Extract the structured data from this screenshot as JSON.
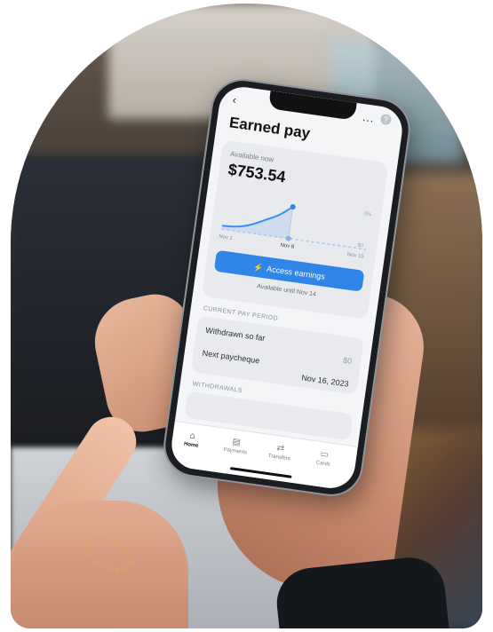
{
  "app": {
    "title": "Earned pay",
    "more": "…",
    "help": "?"
  },
  "earned": {
    "available_label": "Available now",
    "amount": "$753.54",
    "chart": {
      "x_start": "Nov 1",
      "x_marker": "Nov 8",
      "x_end": "Nov 15",
      "y_top": "0%",
      "y_bottom": "$0"
    },
    "access_label": "Access earnings",
    "available_until": "Available until Nov 14"
  },
  "pay_period": {
    "section_label": "CURRENT PAY PERIOD",
    "rows": [
      {
        "label": "Withdrawn so far",
        "value": "$0"
      },
      {
        "label": "Next paycheque",
        "value": "Nov 16, 2023"
      }
    ]
  },
  "withdrawals": {
    "section_label": "WITHDRAWALS"
  },
  "tabs": [
    {
      "label": "Home",
      "icon": "home-icon",
      "glyph": "⌂"
    },
    {
      "label": "Payments",
      "icon": "payments-icon",
      "glyph": "▤"
    },
    {
      "label": "Transfers",
      "icon": "transfers-icon",
      "glyph": "⇄"
    },
    {
      "label": "Cards",
      "icon": "card-icon",
      "glyph": "▭"
    }
  ],
  "colors": {
    "accent": "#2f86e8",
    "background": "#f4f5f7"
  }
}
